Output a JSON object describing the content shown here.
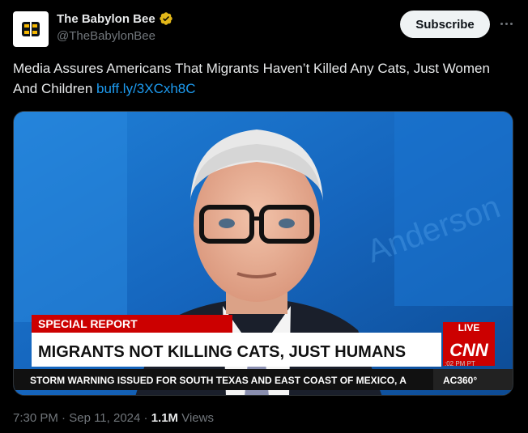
{
  "account": {
    "display_name": "The Babylon Bee",
    "handle": "@TheBabylonBee",
    "verified": true,
    "avatar_icon": "babylon-bee-logo-icon"
  },
  "actions": {
    "subscribe_label": "Subscribe",
    "more_icon": "more-dots-icon"
  },
  "post": {
    "text": "Media Assures Americans That Migrants Haven’t Killed Any Cats, Just Women And Children",
    "link_text": "buff.ly/3XCxh8C"
  },
  "media": {
    "background_watermark": "Anderson",
    "chyron_label": "SPECIAL REPORT",
    "headline": "MIGRANTS NOT KILLING CATS, JUST HUMANS",
    "network": "CNN",
    "live_label": "LIVE",
    "clock": ":02 PM PT",
    "ticker": "STORM WARNING ISSUED FOR SOUTH TEXAS AND EAST COAST OF MEXICO, A",
    "show": "AC360°",
    "colors": {
      "cnn_red": "#cc0000",
      "studio_blue": "#1a6fc4"
    }
  },
  "footer": {
    "time": "7:30 PM",
    "separator": "·",
    "date": "Sep 11, 2024",
    "views_count": "1.1M",
    "views_label": "Views"
  }
}
